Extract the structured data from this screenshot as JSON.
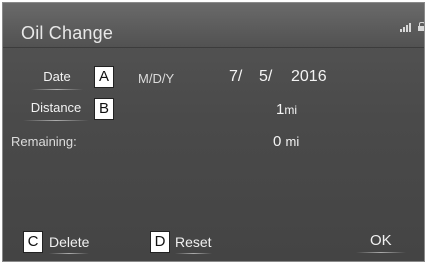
{
  "header": {
    "title": "Oil Change"
  },
  "status_icons": [
    "signal-icon",
    "lock-icon"
  ],
  "rows": {
    "date": {
      "button_label": "Date",
      "format": "M/D/Y",
      "month": "7/",
      "day": "5/",
      "year": "2016"
    },
    "distance": {
      "button_label": "Distance",
      "value": "1",
      "unit": "mi"
    },
    "remaining": {
      "label": "Remaining:",
      "value": "0",
      "unit": "mi"
    }
  },
  "footer": {
    "delete_label": "Delete",
    "reset_label": "Reset",
    "ok_label": "OK"
  },
  "callouts": {
    "a": "A",
    "b": "B",
    "c": "C",
    "d": "D"
  },
  "colors": {
    "background": "#4a4a4a",
    "header": "#5b5b5b",
    "text": "#f2f2f2"
  }
}
